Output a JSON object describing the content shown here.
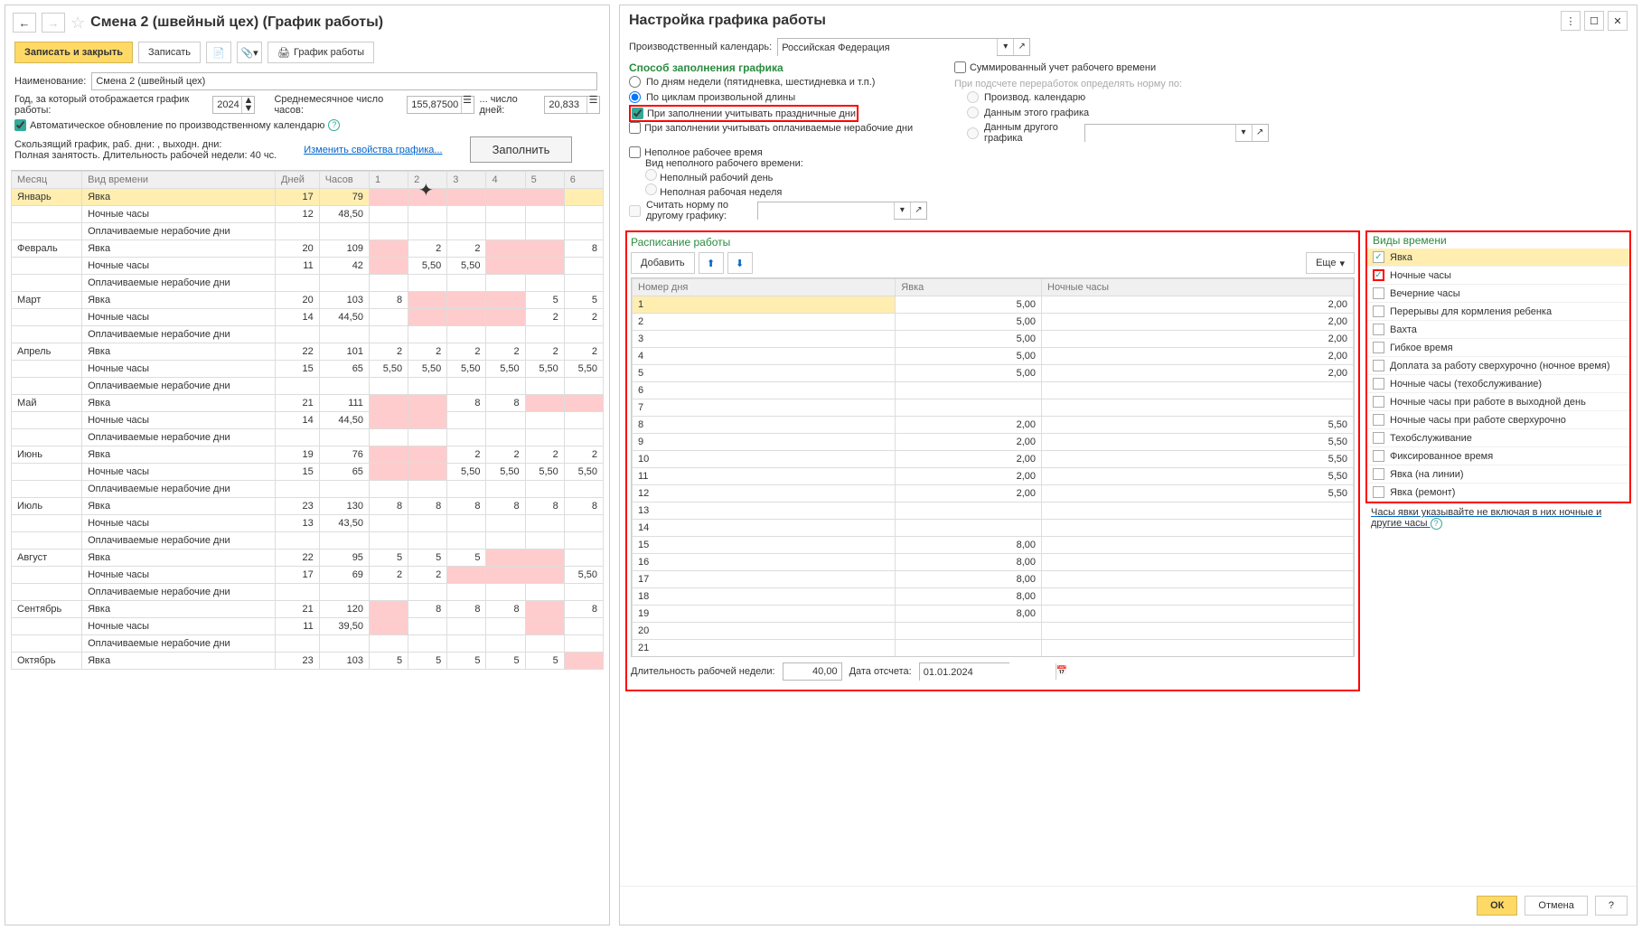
{
  "left": {
    "title": "Смена 2 (швейный цех) (График работы)",
    "save_close": "Записать и закрыть",
    "save": "Записать",
    "graph_btn": "График работы",
    "name_lbl": "Наименование:",
    "name_val": "Смена 2 (швейный цех)",
    "year_lbl": "Год, за который отображается график работы:",
    "year": "2024",
    "avg_h_lbl": "Среднемесячное число часов:",
    "avg_h": "155,87500",
    "days_lbl": "... число дней:",
    "days": "20,833",
    "auto_upd": "Автоматическое обновление по производственному календарю",
    "desc1": "Скользящий график, раб. дни: , выходн. дни:",
    "desc2": "Полная занятость. Длительность рабочей недели: 40 чс.",
    "edit_props": "Изменить свойства графика...",
    "fill_btn": "Заполнить",
    "cols": [
      "Месяц",
      "Вид времени",
      "Дней",
      "Часов",
      "1",
      "2",
      "3",
      "4",
      "5",
      "6"
    ],
    "rows": [
      {
        "m": "Январь",
        "t": "Явка",
        "d": "17",
        "h": "79",
        "c": [
          "",
          "",
          "",
          "",
          "",
          ""
        ],
        "yel": true
      },
      {
        "m": "",
        "t": "Ночные часы",
        "d": "12",
        "h": "48,50",
        "c": [
          "",
          "",
          "",
          "",
          "",
          ""
        ]
      },
      {
        "m": "",
        "t": "Оплачиваемые нерабочие дни",
        "d": "",
        "h": "",
        "c": [
          "",
          "",
          "",
          "",
          "",
          ""
        ]
      },
      {
        "m": "Февраль",
        "t": "Явка",
        "d": "20",
        "h": "109",
        "c": [
          "",
          "2",
          "2",
          "",
          "",
          "8"
        ]
      },
      {
        "m": "",
        "t": "Ночные часы",
        "d": "11",
        "h": "42",
        "c": [
          "",
          "5,50",
          "5,50",
          "",
          "",
          ""
        ]
      },
      {
        "m": "",
        "t": "Оплачиваемые нерабочие дни",
        "d": "",
        "h": "",
        "c": [
          "",
          "",
          "",
          "",
          "",
          ""
        ]
      },
      {
        "m": "Март",
        "t": "Явка",
        "d": "20",
        "h": "103",
        "c": [
          "8",
          "",
          "",
          "",
          "5",
          "5"
        ]
      },
      {
        "m": "",
        "t": "Ночные часы",
        "d": "14",
        "h": "44,50",
        "c": [
          "",
          "",
          "",
          "",
          "2",
          "2"
        ]
      },
      {
        "m": "",
        "t": "Оплачиваемые нерабочие дни",
        "d": "",
        "h": "",
        "c": [
          "",
          "",
          "",
          "",
          "",
          ""
        ]
      },
      {
        "m": "Апрель",
        "t": "Явка",
        "d": "22",
        "h": "101",
        "c": [
          "2",
          "2",
          "2",
          "2",
          "2",
          "2"
        ]
      },
      {
        "m": "",
        "t": "Ночные часы",
        "d": "15",
        "h": "65",
        "c": [
          "5,50",
          "5,50",
          "5,50",
          "5,50",
          "5,50",
          "5,50"
        ]
      },
      {
        "m": "",
        "t": "Оплачиваемые нерабочие дни",
        "d": "",
        "h": "",
        "c": [
          "",
          "",
          "",
          "",
          "",
          ""
        ]
      },
      {
        "m": "Май",
        "t": "Явка",
        "d": "21",
        "h": "111",
        "c": [
          "",
          "",
          "8",
          "8",
          "",
          ""
        ]
      },
      {
        "m": "",
        "t": "Ночные часы",
        "d": "14",
        "h": "44,50",
        "c": [
          "",
          "",
          "",
          "",
          "",
          ""
        ]
      },
      {
        "m": "",
        "t": "Оплачиваемые нерабочие дни",
        "d": "",
        "h": "",
        "c": [
          "",
          "",
          "",
          "",
          "",
          ""
        ]
      },
      {
        "m": "Июнь",
        "t": "Явка",
        "d": "19",
        "h": "76",
        "c": [
          "",
          "",
          "2",
          "2",
          "2",
          "2"
        ]
      },
      {
        "m": "",
        "t": "Ночные часы",
        "d": "15",
        "h": "65",
        "c": [
          "",
          "",
          "5,50",
          "5,50",
          "5,50",
          "5,50"
        ]
      },
      {
        "m": "",
        "t": "Оплачиваемые нерабочие дни",
        "d": "",
        "h": "",
        "c": [
          "",
          "",
          "",
          "",
          "",
          ""
        ]
      },
      {
        "m": "Июль",
        "t": "Явка",
        "d": "23",
        "h": "130",
        "c": [
          "8",
          "8",
          "8",
          "8",
          "8",
          "8"
        ]
      },
      {
        "m": "",
        "t": "Ночные часы",
        "d": "13",
        "h": "43,50",
        "c": [
          "",
          "",
          "",
          "",
          "",
          ""
        ]
      },
      {
        "m": "",
        "t": "Оплачиваемые нерабочие дни",
        "d": "",
        "h": "",
        "c": [
          "",
          "",
          "",
          "",
          "",
          ""
        ]
      },
      {
        "m": "Август",
        "t": "Явка",
        "d": "22",
        "h": "95",
        "c": [
          "5",
          "5",
          "5",
          "",
          "",
          ""
        ]
      },
      {
        "m": "",
        "t": "Ночные часы",
        "d": "17",
        "h": "69",
        "c": [
          "2",
          "2",
          "",
          "",
          "",
          "5,50"
        ]
      },
      {
        "m": "",
        "t": "Оплачиваемые нерабочие дни",
        "d": "",
        "h": "",
        "c": [
          "",
          "",
          "",
          "",
          "",
          ""
        ]
      },
      {
        "m": "Сентябрь",
        "t": "Явка",
        "d": "21",
        "h": "120",
        "c": [
          "",
          "8",
          "8",
          "8",
          "",
          "8"
        ]
      },
      {
        "m": "",
        "t": "Ночные часы",
        "d": "11",
        "h": "39,50",
        "c": [
          "",
          "",
          "",
          "",
          "",
          ""
        ]
      },
      {
        "m": "",
        "t": "Оплачиваемые нерабочие дни",
        "d": "",
        "h": "",
        "c": [
          "",
          "",
          "",
          "",
          "",
          ""
        ]
      },
      {
        "m": "Октябрь",
        "t": "Явка",
        "d": "23",
        "h": "103",
        "c": [
          "5",
          "5",
          "5",
          "5",
          "5",
          ""
        ]
      }
    ]
  },
  "right": {
    "title": "Настройка графика работы",
    "cal_lbl": "Производственный календарь:",
    "cal_val": "Российская Федерация",
    "method_hdr": "Способ заполнения графика",
    "r1": "По дням недели (пятидневка, шестидневка и т.п.)",
    "r2": "По циклам произвольной длины",
    "chk_hol": "При заполнении учитывать праздничные дни",
    "chk_paid": "При заполнении учитывать оплачиваемые нерабочие дни",
    "sum_chk": "Суммированный учет рабочего времени",
    "over_lbl": "При подсчете переработок определять норму по:",
    "or1": "Производ. календарю",
    "or2": "Данным этого графика",
    "or3": "Данным другого графика",
    "part_chk": "Неполное рабочее время",
    "part_kind": "Вид неполного рабочего времени:",
    "pr1": "Неполный рабочий день",
    "pr2": "Неполная рабочая неделя",
    "norm_chk": "Считать норму по другому графику:",
    "sched_hdr": "Расписание работы",
    "add_btn": "Добавить",
    "more_btn": "Еще",
    "sc_cols": [
      "Номер дня",
      "Явка",
      "Ночные часы"
    ],
    "sc_rows": [
      {
        "n": "1",
        "a": "5,00",
        "b": "2,00",
        "sel": true
      },
      {
        "n": "2",
        "a": "5,00",
        "b": "2,00"
      },
      {
        "n": "3",
        "a": "5,00",
        "b": "2,00"
      },
      {
        "n": "4",
        "a": "5,00",
        "b": "2,00"
      },
      {
        "n": "5",
        "a": "5,00",
        "b": "2,00"
      },
      {
        "n": "6",
        "a": "",
        "b": ""
      },
      {
        "n": "7",
        "a": "",
        "b": ""
      },
      {
        "n": "8",
        "a": "2,00",
        "b": "5,50"
      },
      {
        "n": "9",
        "a": "2,00",
        "b": "5,50"
      },
      {
        "n": "10",
        "a": "2,00",
        "b": "5,50"
      },
      {
        "n": "11",
        "a": "2,00",
        "b": "5,50"
      },
      {
        "n": "12",
        "a": "2,00",
        "b": "5,50"
      },
      {
        "n": "13",
        "a": "",
        "b": ""
      },
      {
        "n": "14",
        "a": "",
        "b": ""
      },
      {
        "n": "15",
        "a": "8,00",
        "b": ""
      },
      {
        "n": "16",
        "a": "8,00",
        "b": ""
      },
      {
        "n": "17",
        "a": "8,00",
        "b": ""
      },
      {
        "n": "18",
        "a": "8,00",
        "b": ""
      },
      {
        "n": "19",
        "a": "8,00",
        "b": ""
      },
      {
        "n": "20",
        "a": "",
        "b": ""
      },
      {
        "n": "21",
        "a": "",
        "b": ""
      }
    ],
    "week_len_lbl": "Длительность рабочей недели:",
    "week_len": "40,00",
    "date_lbl": "Дата отсчета:",
    "date_val": "01.01.2024",
    "types_hdr": "Виды времени",
    "types": [
      {
        "l": "Явка",
        "c": true,
        "sel": true
      },
      {
        "l": "Ночные часы",
        "c": true,
        "red": true
      },
      {
        "l": "Вечерние часы"
      },
      {
        "l": "Перерывы для кормления ребенка"
      },
      {
        "l": "Вахта"
      },
      {
        "l": "Гибкое время"
      },
      {
        "l": "Доплата за работу сверхурочно (ночное время)"
      },
      {
        "l": "Ночные часы (техобслуживание)"
      },
      {
        "l": "Ночные часы при работе в выходной день"
      },
      {
        "l": "Ночные часы при работе сверхурочно"
      },
      {
        "l": "Техобслуживание"
      },
      {
        "l": "Фиксированное время"
      },
      {
        "l": "Явка (на линии)"
      },
      {
        "l": "Явка (ремонт)"
      }
    ],
    "hint": "Часы явки указывайте не включая в них ночные и другие часы",
    "ok": "ОК",
    "cancel": "Отмена"
  }
}
